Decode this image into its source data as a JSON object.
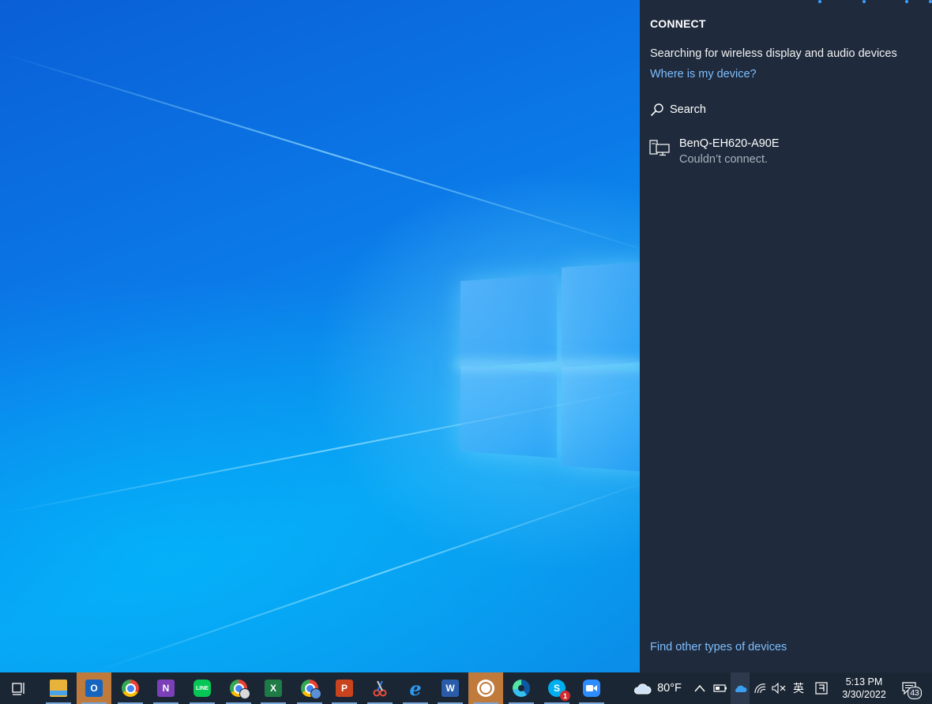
{
  "panel": {
    "title": "CONNECT",
    "searching_text": "Searching for wireless display and audio devices",
    "where_link": "Where is my device?",
    "search_label": "Search",
    "devices": [
      {
        "name": "BenQ-EH620-A90E",
        "status": "Couldn’t connect."
      }
    ],
    "find_other_link": "Find other types of devices",
    "link_color": "#7fbfff",
    "background_color": "#1f2a3c"
  },
  "taskbar": {
    "apps": [
      {
        "icon": "task-view-icon"
      },
      {
        "icon": "file-explorer-icon"
      },
      {
        "icon": "outlook-icon",
        "letter": "O"
      },
      {
        "icon": "chrome-icon"
      },
      {
        "icon": "onenote-icon",
        "letter": "N"
      },
      {
        "icon": "line-icon",
        "letter": "LINE"
      },
      {
        "icon": "chrome-profile-icon"
      },
      {
        "icon": "excel-icon",
        "letter": "X"
      },
      {
        "icon": "chrome-profile-2-icon"
      },
      {
        "icon": "powerpoint-icon",
        "letter": "P"
      },
      {
        "icon": "snipping-tool-icon"
      },
      {
        "icon": "internet-explorer-icon",
        "letter": "e"
      },
      {
        "icon": "word-icon",
        "letter": "W"
      },
      {
        "icon": "app-timer-icon"
      },
      {
        "icon": "edge-icon"
      },
      {
        "icon": "skype-icon",
        "letter": "S",
        "badge": "1"
      },
      {
        "icon": "zoom-icon"
      }
    ],
    "weather": {
      "icon": "cloud-icon",
      "temp": "80°F"
    },
    "tray": {
      "chevron": "chevron-up-icon",
      "battery": "battery-icon",
      "onedrive": "onedrive-icon",
      "wifi": "wifi-icon",
      "volume": "volume-muted-icon",
      "ime": "英",
      "ime_mode": "ime-mode-icon"
    },
    "clock": {
      "time": "5:13 PM",
      "date": "3/30/2022"
    },
    "notifications": {
      "icon": "action-center-icon",
      "count": "43"
    }
  }
}
